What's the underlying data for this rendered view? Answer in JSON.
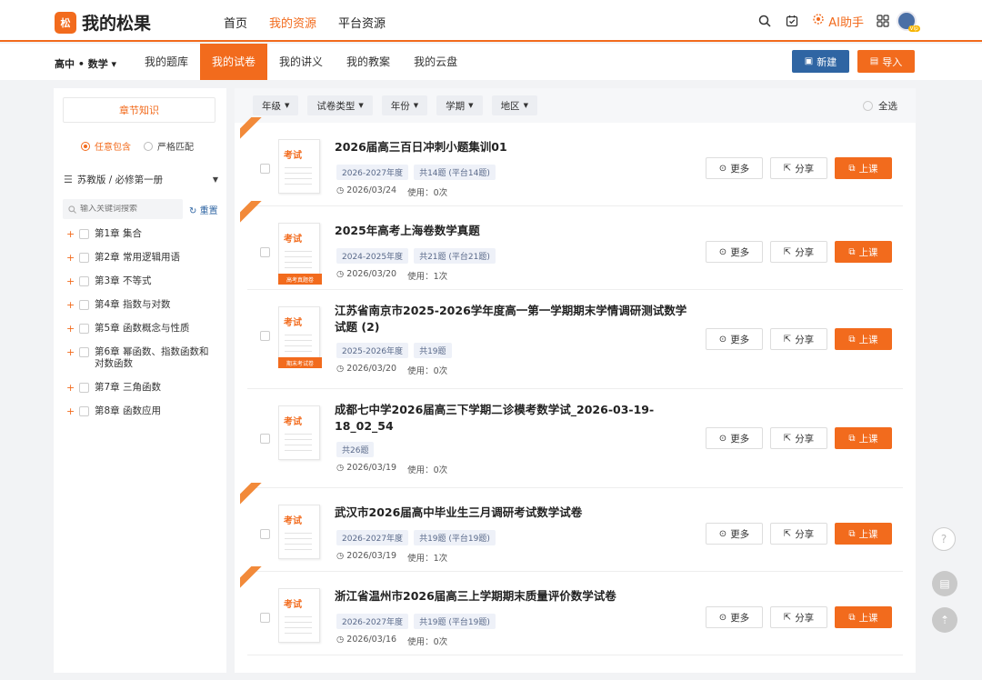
{
  "app": {
    "logo_mark": "松",
    "logo_text": "我的松果"
  },
  "nav": [
    {
      "label": "首页",
      "active": false
    },
    {
      "label": "我的资源",
      "active": true
    },
    {
      "label": "平台资源",
      "active": false
    }
  ],
  "topright": {
    "ai_label": "AI助手",
    "avatar_badge": "Vip"
  },
  "subbar": {
    "subject": "高中 • 数学 ▾",
    "tabs": [
      {
        "label": "我的题库",
        "active": false
      },
      {
        "label": "我的试卷",
        "active": true
      },
      {
        "label": "我的讲义",
        "active": false
      },
      {
        "label": "我的教案",
        "active": false
      },
      {
        "label": "我的云盘",
        "active": false
      }
    ],
    "new_label": "新建",
    "import_label": "导入"
  },
  "sidebar": {
    "chapter_button": "章节知识",
    "match_any": "任意包含",
    "match_strict": "严格匹配",
    "book": "苏教版 / 必修第一册",
    "search_placeholder": "输入关键词搜索",
    "reset_label": "重置",
    "chapters": [
      {
        "label": "第1章 集合"
      },
      {
        "label": "第2章 常用逻辑用语"
      },
      {
        "label": "第3章 不等式"
      },
      {
        "label": "第4章 指数与对数"
      },
      {
        "label": "第5章 函数概念与性质"
      },
      {
        "label": "第6章 幂函数、指数函数和对数函数"
      },
      {
        "label": "第7章 三角函数"
      },
      {
        "label": "第8章 函数应用"
      }
    ]
  },
  "filters": {
    "items": [
      {
        "label": "年级"
      },
      {
        "label": "试卷类型"
      },
      {
        "label": "年份"
      },
      {
        "label": "学期"
      },
      {
        "label": "地区"
      }
    ],
    "select_all": "全选"
  },
  "actions": {
    "more": "更多",
    "share": "分享",
    "teach": "上课"
  },
  "doc_word": "考试",
  "papers": [
    {
      "title": "2026届高三百日冲刺小题集训01",
      "tags": [
        "2026-2027年度",
        "共14题 (平台14题)"
      ],
      "date": "2026/03/24",
      "usage": "使用：0次",
      "ribbon": true,
      "doc_label": ""
    },
    {
      "title": "2025年高考上海卷数学真题",
      "tags": [
        "2024-2025年度",
        "共21题 (平台21题)"
      ],
      "date": "2026/03/20",
      "usage": "使用：1次",
      "ribbon": true,
      "doc_label": "高考真题卷"
    },
    {
      "title": "江苏省南京市2025-2026学年度高一第一学期期末学情调研测试数学试题 (2)",
      "tags": [
        "2025-2026年度",
        "共19题"
      ],
      "date": "2026/03/20",
      "usage": "使用：0次",
      "ribbon": false,
      "doc_label": "期末考试卷"
    },
    {
      "title": "成都七中学2026届高三下学期二诊模考数学试_2026-03-19-18_02_54",
      "tags": [
        "共26题"
      ],
      "date": "2026/03/19",
      "usage": "使用：0次",
      "ribbon": false,
      "doc_label": ""
    },
    {
      "title": "武汉市2026届高中毕业生三月调研考试数学试卷",
      "tags": [
        "2026-2027年度",
        "共19题 (平台19题)"
      ],
      "date": "2026/03/19",
      "usage": "使用：1次",
      "ribbon": true,
      "doc_label": ""
    },
    {
      "title": "浙江省温州市2026届高三上学期期末质量评价数学试卷",
      "tags": [
        "2026-2027年度",
        "共19题 (平台19题)"
      ],
      "date": "2026/03/16",
      "usage": "使用：0次",
      "ribbon": true,
      "doc_label": ""
    }
  ],
  "colors": {
    "accent": "#f26b1d",
    "primary_blue": "#2f65a3"
  }
}
